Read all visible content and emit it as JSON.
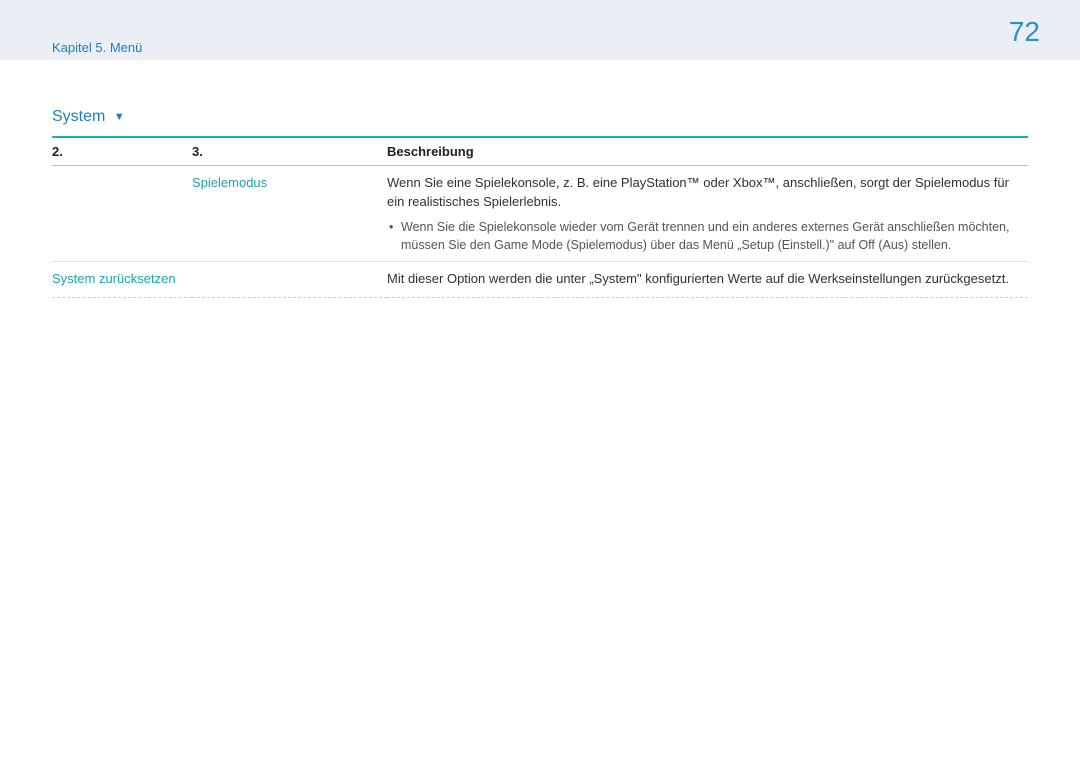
{
  "header": {
    "chapter": "Kapitel 5. Menü",
    "page_number": "72"
  },
  "section": {
    "title": "System",
    "indicator": "▼"
  },
  "table": {
    "headers": {
      "col1": "2.",
      "col2": "3.",
      "col3": "Beschreibung"
    },
    "rows": [
      {
        "col1": "",
        "col2": "Spielemodus",
        "col3_text": "Wenn Sie eine Spielekonsole, z. B. eine PlayStation™ oder Xbox™, anschließen, sorgt der Spielemodus für ein realistisches Spielerlebnis.",
        "col3_bullet": "Wenn Sie die Spielekonsole wieder vom Gerät trennen und ein anderes externes Gerät anschließen möchten, müssen Sie den Game Mode (Spielemodus) über das Menü „Setup (Einstell.)\" auf Off (Aus) stellen."
      },
      {
        "col1": "System zurücksetzen",
        "col2": "",
        "col3_text": "Mit dieser Option werden die unter „System\" konfigurierten Werte auf die Werkseinstellungen zurückgesetzt.",
        "col3_bullet": ""
      }
    ]
  }
}
